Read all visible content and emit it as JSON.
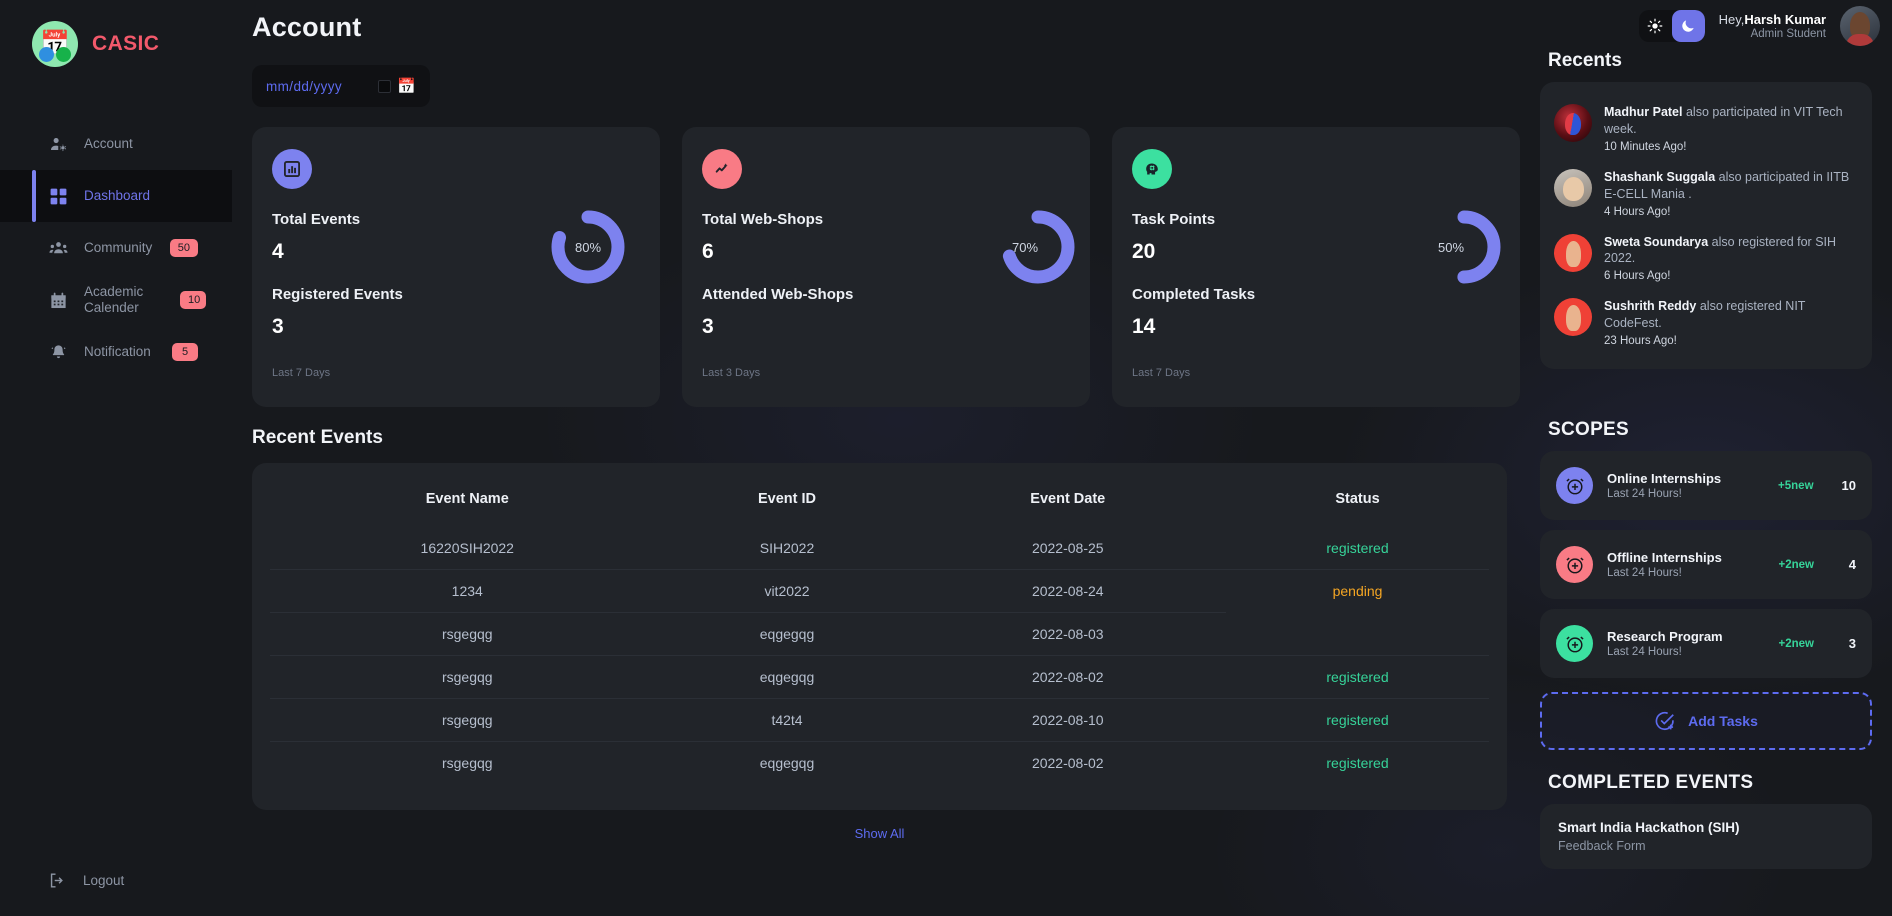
{
  "brand": {
    "name": "CASIC",
    "logo_icon": "calendar-logo-icon"
  },
  "sidebar": {
    "items": [
      {
        "label": "Account",
        "icon": "account-user-gear-icon",
        "badge": null,
        "active": false
      },
      {
        "label": "Dashboard",
        "icon": "dashboard-grid-icon",
        "badge": null,
        "active": true
      },
      {
        "label": "Community",
        "icon": "community-people-icon",
        "badge": "50",
        "active": false
      },
      {
        "label": "Academic Calender",
        "icon": "calendar-icon",
        "badge": "10",
        "active": false
      },
      {
        "label": "Notification",
        "icon": "bell-icon",
        "badge": "5",
        "active": false
      }
    ],
    "logout": {
      "label": "Logout",
      "icon": "logout-icon"
    }
  },
  "header": {
    "page_title": "Account",
    "theme": {
      "light_icon": "sun-icon",
      "dark_icon": "moon-icon",
      "active": "dark"
    },
    "user": {
      "greeting": "Hey,",
      "name": "Harsh Kumar",
      "role": "Admin Student",
      "avatar": "user-avatar"
    }
  },
  "date_filter": {
    "placeholder": "mm/dd/yyyy",
    "mm": "mm",
    "dd": "dd",
    "yyyy": "yyyy",
    "icon": "calendar-picker-icon"
  },
  "cards": [
    {
      "icon": "bar-chart-icon",
      "icon_bg": "#7d82ef",
      "label": "Total Events",
      "value": "4",
      "sub_label": "Registered Events",
      "sub_value": "3",
      "footer": "Last 7 Days",
      "percent": 80,
      "percent_label": "80%"
    },
    {
      "icon": "trend-up-icon",
      "icon_bg": "#f97b85",
      "label": "Total Web-Shops",
      "value": "6",
      "sub_label": "Attended Web-Shops",
      "sub_value": "3",
      "footer": "Last 3 Days",
      "percent": 70,
      "percent_label": "70%"
    },
    {
      "icon": "brain-gear-icon",
      "icon_bg": "#3ce0a0",
      "label": "Task Points",
      "value": "20",
      "sub_label": "Completed Tasks",
      "sub_value": "14",
      "footer": "Last 7 Days",
      "percent": 50,
      "percent_label": "50%"
    }
  ],
  "recent_events": {
    "title": "Recent Events",
    "columns": [
      "Event Name",
      "Event ID",
      "Event Date",
      "Status"
    ],
    "rows": [
      {
        "name": "16220SIH2022",
        "id": "SIH2022",
        "date": "2022-08-25",
        "status": "registered",
        "status_type": "registered"
      },
      {
        "name": "1234",
        "id": "vit2022",
        "date": "2022-08-24",
        "status": "pending",
        "status_type": "pending"
      },
      {
        "name": "rsgegqg",
        "id": "eqgegqg",
        "date": "2022-08-03",
        "status": "",
        "status_type": "none"
      },
      {
        "name": "rsgegqg",
        "id": "eqgegqg",
        "date": "2022-08-02",
        "status": "registered",
        "status_type": "registered"
      },
      {
        "name": "rsgegqg",
        "id": "t42t4",
        "date": "2022-08-10",
        "status": "registered",
        "status_type": "registered"
      },
      {
        "name": "rsgegqg",
        "id": "eqgegqg",
        "date": "2022-08-02",
        "status": "registered",
        "status_type": "registered"
      }
    ],
    "show_all": "Show All"
  },
  "recents": {
    "title": "Recents",
    "items": [
      {
        "name": "Madhur Patel",
        "text": " also participated in VIT Tech week.",
        "time": "10 Minutes Ago!",
        "avatar": "avatar-madhur"
      },
      {
        "name": "Shashank Suggala",
        "text": " also participated in IITB E-CELL Mania .",
        "time": "4 Hours Ago!",
        "avatar": "avatar-shashank"
      },
      {
        "name": "Sweta Soundarya",
        "text": " also registered for SIH 2022.",
        "time": "6 Hours Ago!",
        "avatar": "avatar-sweta"
      },
      {
        "name": "Sushrith Reddy",
        "text": " also registered NIT CodeFest.",
        "time": "23 Hours Ago!",
        "avatar": "avatar-sushrith"
      }
    ]
  },
  "scopes": {
    "title": "SCOPES",
    "items": [
      {
        "name": "Online Internships",
        "sub": "Last 24 Hours!",
        "new": "+5new",
        "count": "10",
        "icon": "alarm-plus-icon",
        "color": "#7d82ef"
      },
      {
        "name": "Offline Internships",
        "sub": "Last 24 Hours!",
        "new": "+2new",
        "count": "4",
        "icon": "alarm-plus-icon",
        "color": "#f97b85"
      },
      {
        "name": "Research Program",
        "sub": "Last 24 Hours!",
        "new": "+2new",
        "count": "3",
        "icon": "alarm-plus-icon",
        "color": "#3ce0a0"
      }
    ]
  },
  "add_tasks": {
    "label": "Add Tasks",
    "icon": "check-circle-plus-icon"
  },
  "completed_events": {
    "title": "COMPLETED EVENTS",
    "items": [
      {
        "title": "Smart India Hackathon (SIH)",
        "subtitle": "Feedback Form"
      }
    ]
  },
  "chart_data": {
    "type": "pie",
    "title": "Dashboard donut progress gauges",
    "charts": [
      {
        "label": "Total Events",
        "value": 80,
        "unit": "%",
        "color": "#7d82ef",
        "track": "transparent"
      },
      {
        "label": "Total Web-Shops",
        "value": 70,
        "unit": "%",
        "color": "#7d82ef",
        "track": "transparent"
      },
      {
        "label": "Task Points",
        "value": 50,
        "unit": "%",
        "color": "#7d82ef",
        "track": "transparent"
      }
    ],
    "legend": "none"
  }
}
